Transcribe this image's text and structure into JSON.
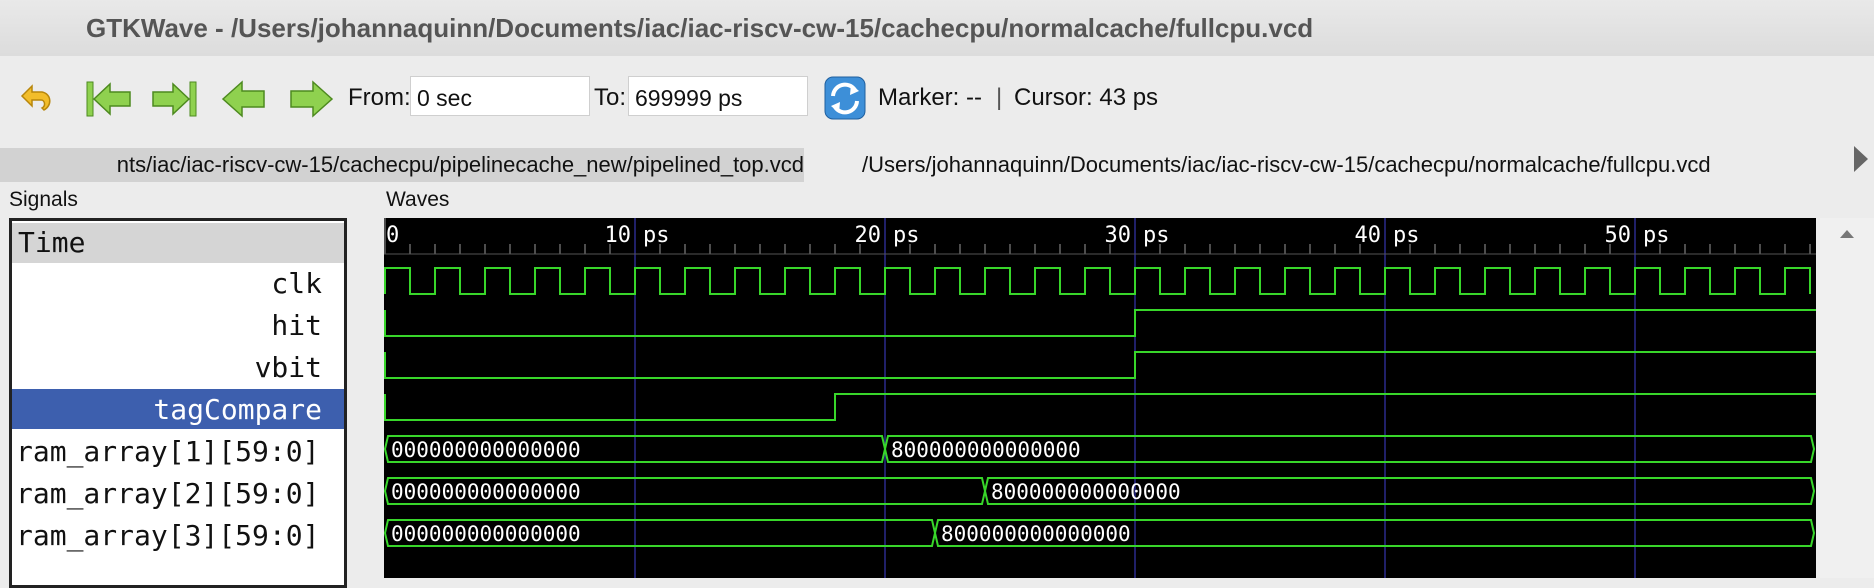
{
  "window": {
    "title": "GTKWave - /Users/johannaquinn/Documents/iac/iac-riscv-cw-15/cachecpu/normalcache/fullcpu.vcd"
  },
  "toolbar": {
    "buttons": [
      {
        "name": "undo",
        "icon": "undo-icon"
      },
      {
        "name": "jump-to-start",
        "icon": "jump-start-icon"
      },
      {
        "name": "jump-to-end",
        "icon": "jump-end-icon"
      },
      {
        "name": "prev-edge",
        "icon": "arrow-left-icon"
      },
      {
        "name": "next-edge",
        "icon": "arrow-right-icon"
      },
      {
        "name": "reload",
        "icon": "reload-icon"
      }
    ],
    "from_label": "From:",
    "from_value": "0 sec",
    "to_label": "To:",
    "to_value": "699999 ps",
    "marker_text": "Marker: --",
    "separator": "|",
    "cursor_text": "Cursor: 43 ps"
  },
  "tabs": [
    {
      "label": "/Users/johannaquinn/Documents/iac/iac-riscv-cw-15/cachecpu/pipelinecache_new/pipelined_top.vcd",
      "shown_text": "nts/iac/iac-riscv-cw-15/cachecpu/pipelinecache_new/pipelined_top.vcd",
      "active": false
    },
    {
      "label": "/Users/johannaquinn/Documents/iac/iac-riscv-cw-15/cachecpu/normalcache/fullcpu.vcd",
      "shown_text": "/Users/johannaquinn/Documents/iac/iac-riscv-cw-15/cachecpu/normalcache/fullcpu.vcd",
      "active": true
    }
  ],
  "panes": {
    "signals_label": "Signals",
    "waves_label": "Waves"
  },
  "signals": {
    "header": "Time",
    "items": [
      {
        "name": "clk",
        "selected": false
      },
      {
        "name": "hit",
        "selected": false
      },
      {
        "name": "vbit",
        "selected": false
      },
      {
        "name": "tagCompare",
        "selected": true
      },
      {
        "name": "ram_array[1][59:0]",
        "selected": false
      },
      {
        "name": "ram_array[2][59:0]",
        "selected": false
      },
      {
        "name": "ram_array[3][59:0]",
        "selected": false
      }
    ]
  },
  "waves": {
    "time_unit": "ps",
    "view_end_ps": 57,
    "ruler_labels": [
      {
        "t": 0,
        "text": "0"
      },
      {
        "t": 10,
        "text": "10 ps"
      },
      {
        "t": 20,
        "text": "20 ps"
      },
      {
        "t": 30,
        "text": "30 ps"
      },
      {
        "t": 40,
        "text": "40 ps"
      },
      {
        "t": 50,
        "text": "50 ps"
      }
    ],
    "clk_period_ps": 2,
    "traces": [
      {
        "signal": "clk",
        "type": "clock"
      },
      {
        "signal": "hit",
        "type": "bit",
        "initial": 0,
        "transitions": [
          {
            "t": 30,
            "v": 1
          }
        ]
      },
      {
        "signal": "vbit",
        "type": "bit",
        "initial": 0,
        "transitions": [
          {
            "t": 30,
            "v": 1
          }
        ]
      },
      {
        "signal": "tagCompare",
        "type": "bit",
        "initial": 0,
        "transitions": [
          {
            "t": 18,
            "v": 1
          }
        ]
      },
      {
        "signal": "ram_array[1][59:0]",
        "type": "bus",
        "segments": [
          {
            "t": 0,
            "v": "000000000000000"
          },
          {
            "t": 20,
            "v": "800000000000000"
          }
        ]
      },
      {
        "signal": "ram_array[2][59:0]",
        "type": "bus",
        "segments": [
          {
            "t": 0,
            "v": "000000000000000"
          },
          {
            "t": 24,
            "v": "800000000000000"
          }
        ]
      },
      {
        "signal": "ram_array[3][59:0]",
        "type": "bus",
        "segments": [
          {
            "t": 0,
            "v": "000000000000000"
          },
          {
            "t": 22,
            "v": "800000000000000"
          }
        ]
      }
    ],
    "colors": {
      "background": "#000000",
      "trace": "#38d62a",
      "grid": "#2b2b8c",
      "ruler_text": "#ffffff",
      "bus_text": "#ffffff"
    }
  }
}
